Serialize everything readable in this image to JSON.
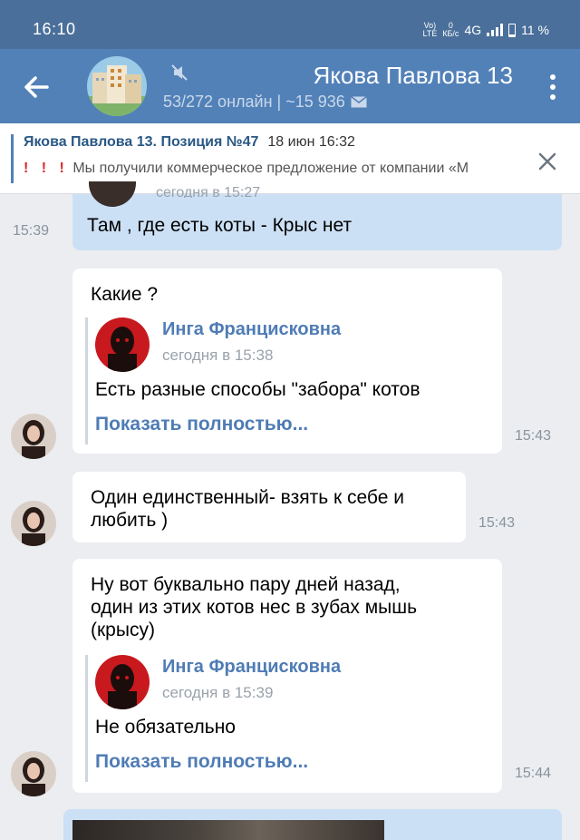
{
  "status_bar": {
    "time": "16:10",
    "volte": "Vo)",
    "lte": "LTE",
    "speed_value": "0",
    "speed_unit": "КБ/с",
    "network": "4G",
    "battery": "11 %"
  },
  "header": {
    "title": "Якова Павлова 13",
    "subtitle": "53/272 онлайн | ~15 936",
    "back_icon": "arrow-left-icon",
    "mute_icon": "mute-icon",
    "menu_icon": "more-vertical-icon"
  },
  "pinned": {
    "title": "Якова Павлова 13. Позиция №47",
    "date": "18 июн 16:32",
    "marks": "! ! !",
    "text": "Мы получили коммерческое предложение от компании «М",
    "close_icon": "close-icon"
  },
  "messages": [
    {
      "id": "m0",
      "direction": "out",
      "quote_time_partial": "сегодня в 15:27",
      "text": "Там , где есть коты - Крыс нет",
      "time": "15:39"
    },
    {
      "id": "m1",
      "direction": "in",
      "text": "Какие ?",
      "quote": {
        "name": "Инга Францисковна",
        "time": "сегодня в 15:38",
        "text": "Есть разные способы \"забора\" котов",
        "more": "Показать полностью..."
      },
      "time": "15:43"
    },
    {
      "id": "m2",
      "direction": "in",
      "text": "Один единственный- взять к себе и\nлюбить )",
      "time": "15:43"
    },
    {
      "id": "m3",
      "direction": "in",
      "text": "Ну вот буквально пару дней назад,\nодин из этих котов нес в зубах мышь\n(крысу)",
      "quote": {
        "name": "Инга Францисковна",
        "time": "сегодня в 15:39",
        "text": "Не обязательно",
        "more": "Показать полностью..."
      },
      "time": "15:44"
    }
  ],
  "colors": {
    "header": "#5281b8",
    "status": "#4a6f9a",
    "link": "#4f7cb5",
    "outgoing": "#cce0f5",
    "background": "#ebedf0"
  }
}
